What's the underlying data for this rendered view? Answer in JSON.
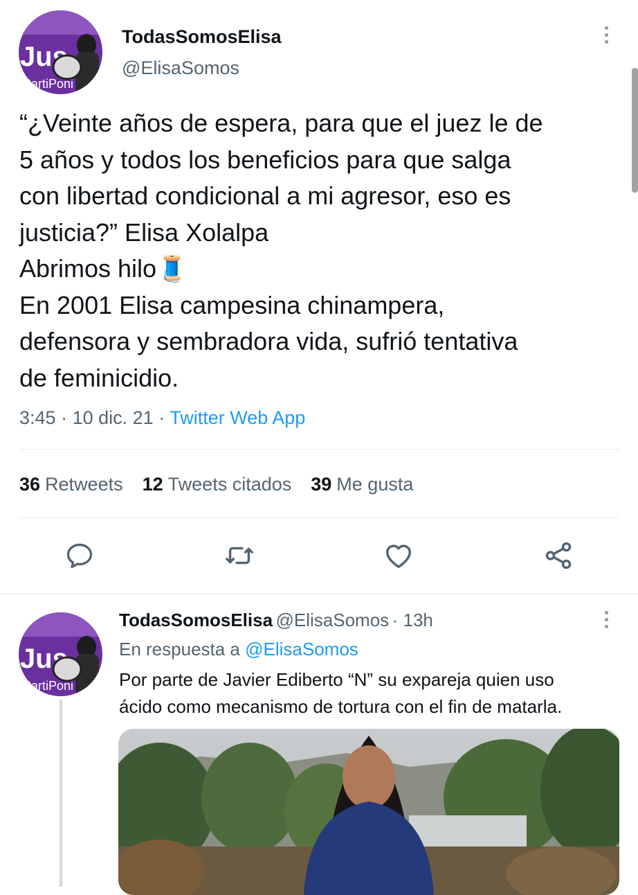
{
  "colors": {
    "accent": "#1d9bf0",
    "text": "#0f1419",
    "secondary": "#536471",
    "divider": "#e6e9ec",
    "avatar_purple": "#6b2fa0"
  },
  "main_tweet": {
    "display_name": "TodasSomosElisa",
    "handle": "@ElisaSomos",
    "body": "“¿Veinte años de espera, para que el juez le de\n5 años y todos los beneficios para que salga\ncon libertad condicional a mi agresor, eso es\njusticia?” Elisa Xolalpa\nAbrimos hilo🧵\nEn 2001 Elisa campesina chinampera,\ndefensora y sembradora vida, sufrió tentativa\nde feminicidio.",
    "time": "3:45",
    "date": "10 dic. 21",
    "separator": "·",
    "source": "Twitter Web App",
    "stats": [
      {
        "count": "36",
        "label": "Retweets"
      },
      {
        "count": "12",
        "label": "Tweets citados"
      },
      {
        "count": "39",
        "label": "Me gusta"
      }
    ],
    "actions": [
      "reply-icon",
      "retweet-icon",
      "like-icon",
      "share-icon"
    ]
  },
  "reply_tweet": {
    "display_name": "TodasSomosElisa",
    "handle": "@ElisaSomos",
    "age": "· 13h",
    "in_reply_prefix": "En respuesta a",
    "in_reply_handle": "@ElisaSomos",
    "body": "Por parte de Javier Ediberto “N” su expareja quien uso\nácido como mecanismo de tortura con el fin de matarla."
  }
}
